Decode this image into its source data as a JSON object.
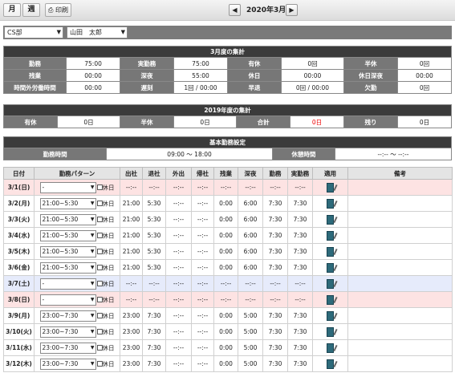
{
  "toolbar": {
    "month_view": "月",
    "week_view": "週",
    "print_label": "印刷",
    "prev": "◀",
    "next": "▶",
    "current_month": "2020年3月"
  },
  "filters": {
    "department": "CS部",
    "employee": "山田　太郎"
  },
  "monthly_summary": {
    "title": "3月度の集計",
    "row1": [
      "勤務",
      "75:00",
      "実勤務",
      "75:00",
      "有休",
      "0回",
      "半休",
      "0回"
    ],
    "row2": [
      "残業",
      "00:00",
      "深夜",
      "55:00",
      "休日",
      "00:00",
      "休日深夜",
      "00:00"
    ],
    "row3": [
      "時間外労働時間",
      "00:00",
      "遅刻",
      "1回 / 00:00",
      "早退",
      "0回 / 00:00",
      "欠勤",
      "0回"
    ]
  },
  "annual_summary": {
    "title": "2019年度の集計",
    "cells": [
      "有休",
      "0日",
      "半休",
      "0日",
      "合計",
      "0日",
      "残り",
      "0日"
    ]
  },
  "work_settings": {
    "title": "基本勤務設定",
    "work_time_label": "勤務時間",
    "work_time_value": "09:00 ～ 18:00",
    "break_label": "休憩時間",
    "break_value": "--:-- ～ --:--"
  },
  "daily": {
    "headers": [
      "日付",
      "勤務パターン",
      "出社",
      "退社",
      "外出",
      "帰社",
      "残業",
      "深夜",
      "勤務",
      "実勤務",
      "適用",
      "備考"
    ],
    "holiday_label": "休日",
    "rows": [
      {
        "date": "3/1(日)",
        "pattern": "-",
        "in": "--:--",
        "out": "--:--",
        "go": "--:--",
        "back": "--:--",
        "ot": "--:--",
        "night": "--:--",
        "work": "--:--",
        "actual": "--:--",
        "kind": "sun"
      },
      {
        "date": "3/2(月)",
        "pattern": "21:00~5:30",
        "in": "21:00",
        "out": "5:30",
        "go": "--:--",
        "back": "--:--",
        "ot": "0:00",
        "night": "6:00",
        "work": "7:30",
        "actual": "7:30",
        "kind": "week"
      },
      {
        "date": "3/3(火)",
        "pattern": "21:00~5:30",
        "in": "21:00",
        "out": "5:30",
        "go": "--:--",
        "back": "--:--",
        "ot": "0:00",
        "night": "6:00",
        "work": "7:30",
        "actual": "7:30",
        "kind": "week"
      },
      {
        "date": "3/4(水)",
        "pattern": "21:00~5:30",
        "in": "21:00",
        "out": "5:30",
        "go": "--:--",
        "back": "--:--",
        "ot": "0:00",
        "night": "6:00",
        "work": "7:30",
        "actual": "7:30",
        "kind": "week"
      },
      {
        "date": "3/5(木)",
        "pattern": "21:00~5:30",
        "in": "21:00",
        "out": "5:30",
        "go": "--:--",
        "back": "--:--",
        "ot": "0:00",
        "night": "6:00",
        "work": "7:30",
        "actual": "7:30",
        "kind": "week"
      },
      {
        "date": "3/6(金)",
        "pattern": "21:00~5:30",
        "in": "21:00",
        "out": "5:30",
        "go": "--:--",
        "back": "--:--",
        "ot": "0:00",
        "night": "6:00",
        "work": "7:30",
        "actual": "7:30",
        "kind": "week"
      },
      {
        "date": "3/7(土)",
        "pattern": "-",
        "in": "--:--",
        "out": "--:--",
        "go": "--:--",
        "back": "--:--",
        "ot": "--:--",
        "night": "--:--",
        "work": "--:--",
        "actual": "--:--",
        "kind": "sat"
      },
      {
        "date": "3/8(日)",
        "pattern": "-",
        "in": "--:--",
        "out": "--:--",
        "go": "--:--",
        "back": "--:--",
        "ot": "--:--",
        "night": "--:--",
        "work": "--:--",
        "actual": "--:--",
        "kind": "sun"
      },
      {
        "date": "3/9(月)",
        "pattern": "23:00~7:30",
        "in": "23:00",
        "out": "7:30",
        "go": "--:--",
        "back": "--:--",
        "ot": "0:00",
        "night": "5:00",
        "work": "7:30",
        "actual": "7:30",
        "kind": "week"
      },
      {
        "date": "3/10(火)",
        "pattern": "23:00~7:30",
        "in": "23:00",
        "out": "7:30",
        "go": "--:--",
        "back": "--:--",
        "ot": "0:00",
        "night": "5:00",
        "work": "7:30",
        "actual": "7:30",
        "kind": "week"
      },
      {
        "date": "3/11(水)",
        "pattern": "23:00~7:30",
        "in": "23:00",
        "out": "7:30",
        "go": "--:--",
        "back": "--:--",
        "ot": "0:00",
        "night": "5:00",
        "work": "7:30",
        "actual": "7:30",
        "kind": "week"
      },
      {
        "date": "3/12(木)",
        "pattern": "23:00~7:30",
        "in": "23:00",
        "out": "7:30",
        "go": "--:--",
        "back": "--:--",
        "ot": "0:00",
        "night": "5:00",
        "work": "7:30",
        "actual": "7:30",
        "kind": "week"
      }
    ]
  }
}
